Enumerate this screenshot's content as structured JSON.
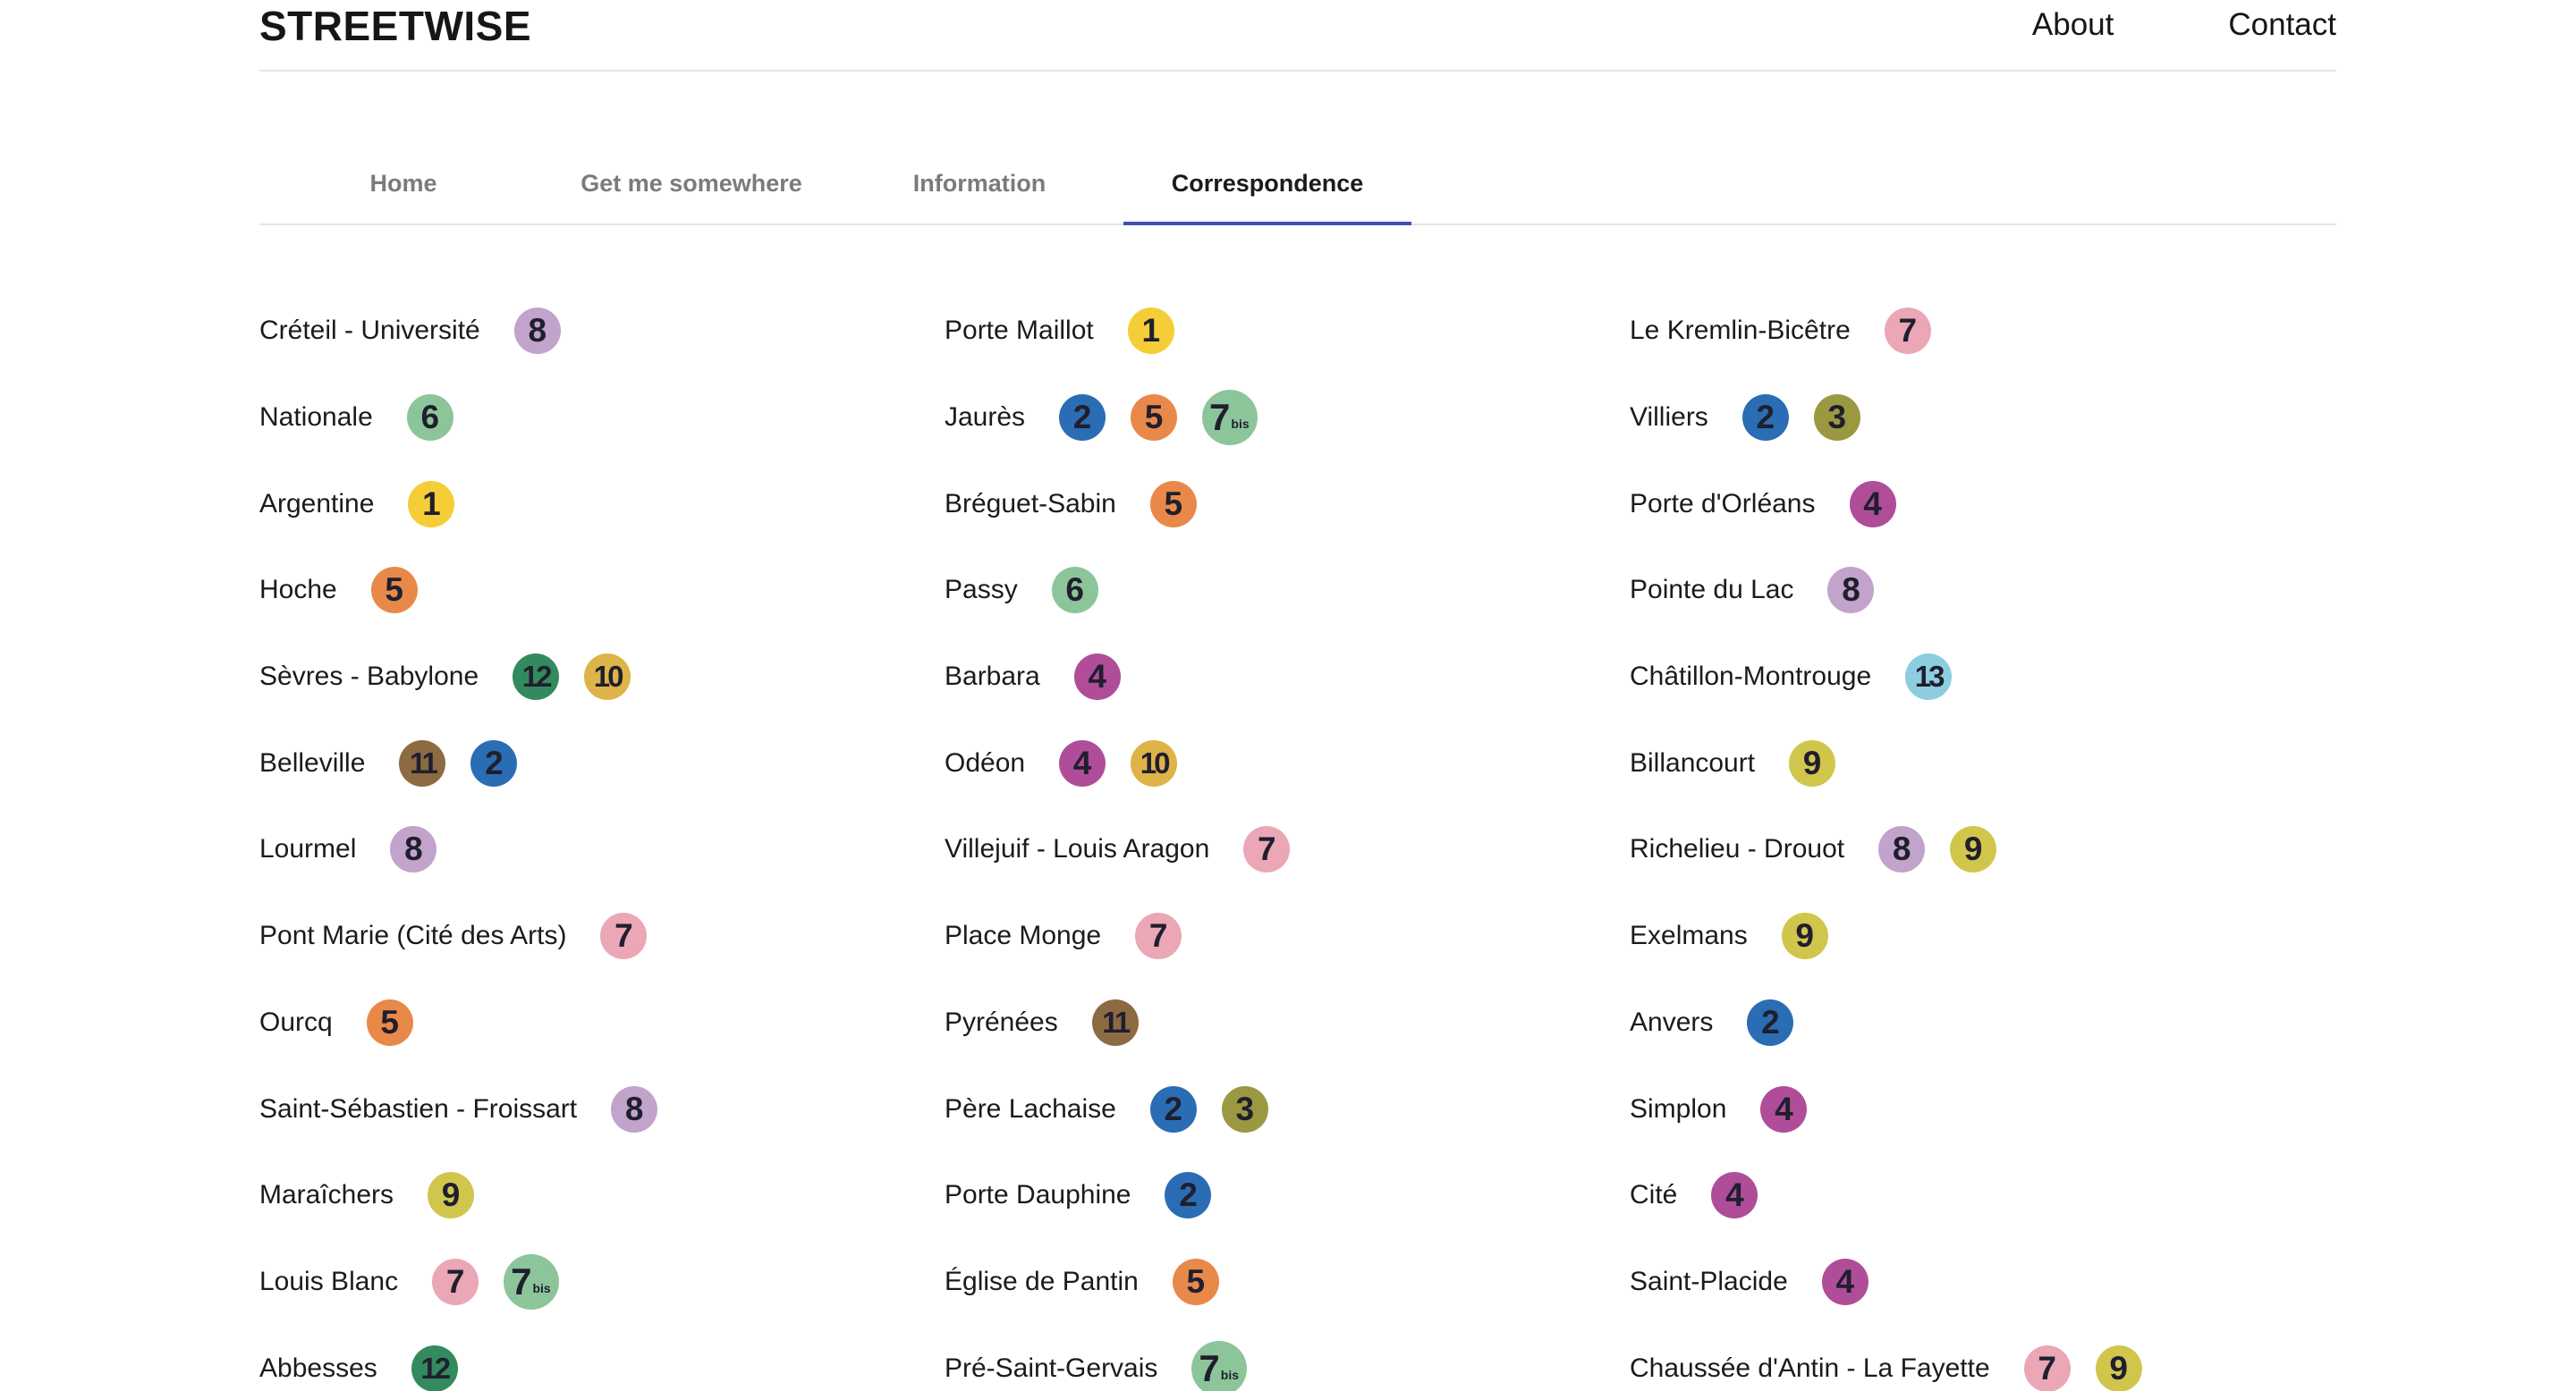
{
  "header": {
    "brand": "STREETWISE",
    "nav": [
      {
        "label": "About"
      },
      {
        "label": "Contact"
      }
    ]
  },
  "tabs": [
    {
      "label": "Home",
      "active": false
    },
    {
      "label": "Get me somewhere",
      "active": false
    },
    {
      "label": "Information",
      "active": false
    },
    {
      "label": "Correspondence",
      "active": true
    }
  ],
  "line_colors": {
    "1": "#f5cd36",
    "2": "#2b6db4",
    "3": "#9b9842",
    "4": "#b04d99",
    "5": "#e8894a",
    "6": "#8cc59a",
    "7": "#eba7b5",
    "7bis": "#8cc59a",
    "8": "#c2a3cc",
    "9": "#d1c64c",
    "10": "#deb347",
    "11": "#8c6a42",
    "12": "#338a5e",
    "13": "#8dcde0"
  },
  "columns": [
    [
      {
        "name": "Créteil - Université",
        "lines": [
          "8"
        ]
      },
      {
        "name": "Nationale",
        "lines": [
          "6"
        ]
      },
      {
        "name": "Argentine",
        "lines": [
          "1"
        ]
      },
      {
        "name": "Hoche",
        "lines": [
          "5"
        ]
      },
      {
        "name": "Sèvres - Babylone",
        "lines": [
          "12",
          "10"
        ]
      },
      {
        "name": "Belleville",
        "lines": [
          "11",
          "2"
        ]
      },
      {
        "name": "Lourmel",
        "lines": [
          "8"
        ]
      },
      {
        "name": "Pont Marie (Cité des Arts)",
        "lines": [
          "7"
        ]
      },
      {
        "name": "Ourcq",
        "lines": [
          "5"
        ]
      },
      {
        "name": "Saint-Sébastien - Froissart",
        "lines": [
          "8"
        ]
      },
      {
        "name": "Maraîchers",
        "lines": [
          "9"
        ]
      },
      {
        "name": "Louis Blanc",
        "lines": [
          "7",
          "7bis"
        ]
      },
      {
        "name": "Abbesses",
        "lines": [
          "12"
        ]
      }
    ],
    [
      {
        "name": "Porte Maillot",
        "lines": [
          "1"
        ]
      },
      {
        "name": "Jaurès",
        "lines": [
          "2",
          "5",
          "7bis"
        ]
      },
      {
        "name": "Bréguet-Sabin",
        "lines": [
          "5"
        ]
      },
      {
        "name": "Passy",
        "lines": [
          "6"
        ]
      },
      {
        "name": "Barbara",
        "lines": [
          "4"
        ]
      },
      {
        "name": "Odéon",
        "lines": [
          "4",
          "10"
        ]
      },
      {
        "name": "Villejuif - Louis Aragon",
        "lines": [
          "7"
        ]
      },
      {
        "name": "Place Monge",
        "lines": [
          "7"
        ]
      },
      {
        "name": "Pyrénées",
        "lines": [
          "11"
        ]
      },
      {
        "name": "Père Lachaise",
        "lines": [
          "2",
          "3"
        ]
      },
      {
        "name": "Porte Dauphine",
        "lines": [
          "2"
        ]
      },
      {
        "name": "Église de Pantin",
        "lines": [
          "5"
        ]
      },
      {
        "name": "Pré-Saint-Gervais",
        "lines": [
          "7bis"
        ]
      }
    ],
    [
      {
        "name": "Le Kremlin-Bicêtre",
        "lines": [
          "7"
        ]
      },
      {
        "name": "Villiers",
        "lines": [
          "2",
          "3"
        ]
      },
      {
        "name": "Porte d'Orléans",
        "lines": [
          "4"
        ]
      },
      {
        "name": "Pointe du Lac",
        "lines": [
          "8"
        ]
      },
      {
        "name": "Châtillon-Montrouge",
        "lines": [
          "13"
        ]
      },
      {
        "name": "Billancourt",
        "lines": [
          "9"
        ]
      },
      {
        "name": "Richelieu - Drouot",
        "lines": [
          "8",
          "9"
        ]
      },
      {
        "name": "Exelmans",
        "lines": [
          "9"
        ]
      },
      {
        "name": "Anvers",
        "lines": [
          "2"
        ]
      },
      {
        "name": "Simplon",
        "lines": [
          "4"
        ]
      },
      {
        "name": "Cité",
        "lines": [
          "4"
        ]
      },
      {
        "name": "Saint-Placide",
        "lines": [
          "4"
        ]
      },
      {
        "name": "Chaussée d'Antin - La Fayette",
        "lines": [
          "7",
          "9"
        ]
      }
    ]
  ]
}
